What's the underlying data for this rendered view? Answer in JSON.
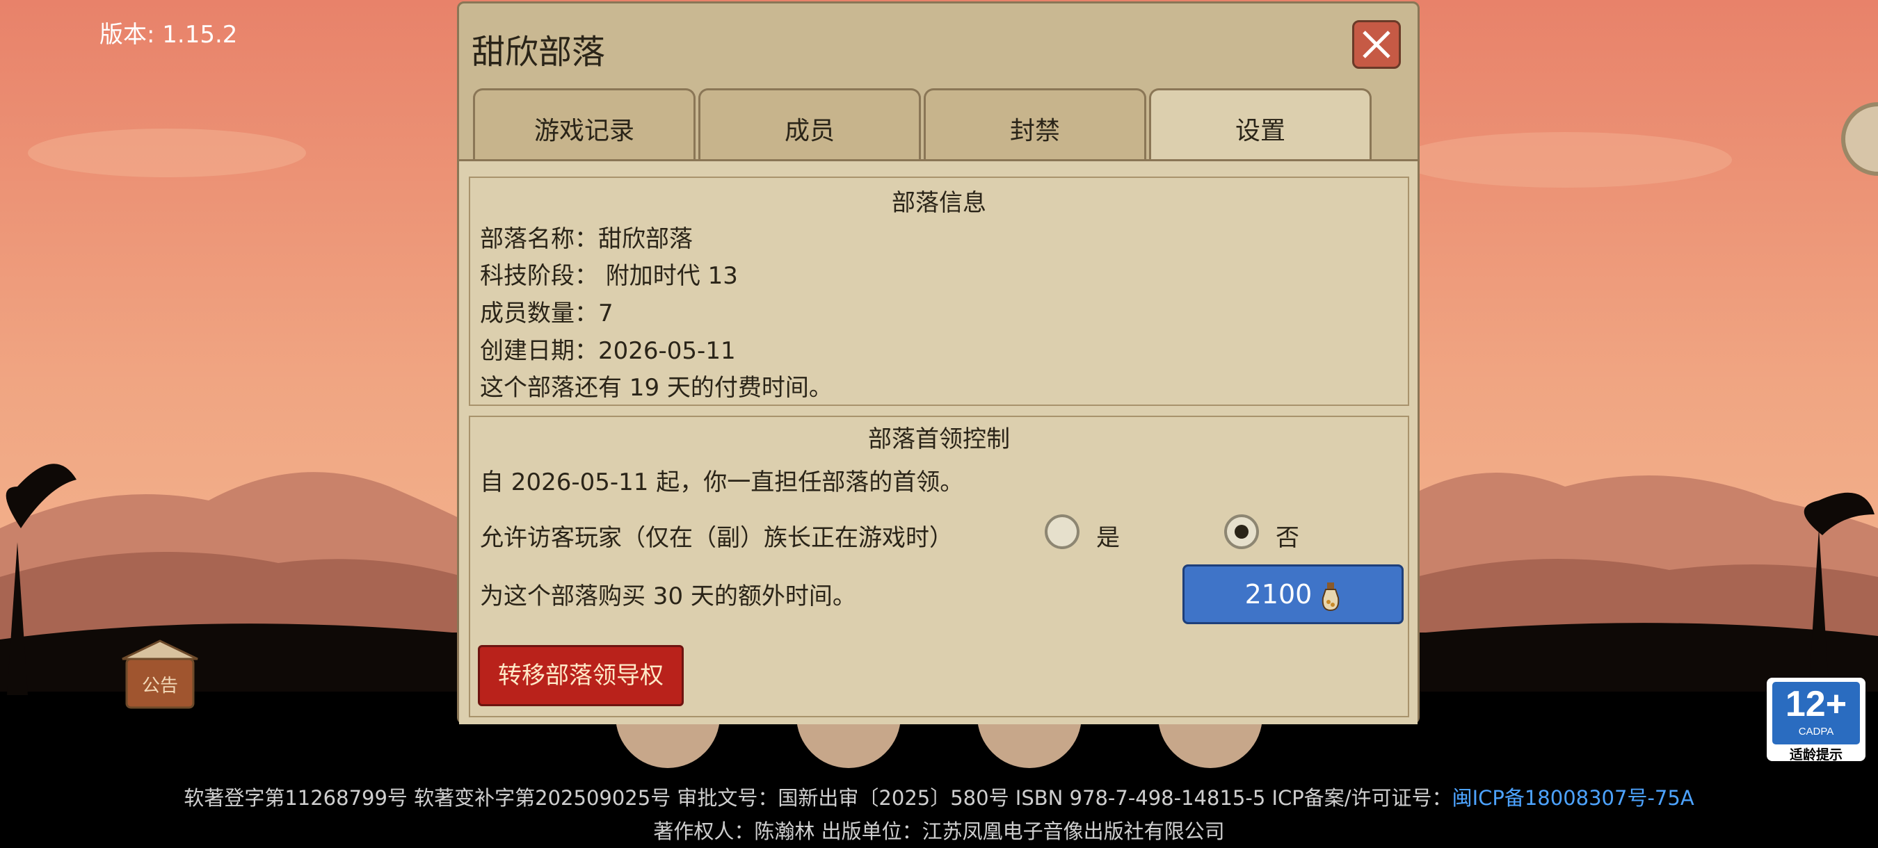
{
  "version_label": "版本: 1.15.2",
  "notice_label": "公告",
  "age_rating": {
    "number": "12+",
    "org": "CADPA",
    "tip": "适龄提示"
  },
  "footer": {
    "line1": "软著登字第11268799号 软著变补字第202509025号 审批文号：国新出审〔2025〕580号 ISBN 978-7-498-14815-5 ICP备案/许可证号：",
    "icp": "闽ICP备18008307号-75A",
    "line2": "著作权人：陈瀚林 出版单位：江苏凤凰电子音像出版社有限公司"
  },
  "dialog": {
    "title": "甜欣部落",
    "tabs": [
      {
        "label": "游戏记录"
      },
      {
        "label": "成员"
      },
      {
        "label": "封禁"
      },
      {
        "label": "设置"
      }
    ],
    "active_tab": "设置",
    "info": {
      "title": "部落信息",
      "name": "部落名称：甜欣部落",
      "tech": "科技阶段： 附加时代 13",
      "members": "成员数量：7",
      "created": "创建日期：2026-05-11",
      "paid": "这个部落还有 19 天的付费时间。"
    },
    "leader": {
      "title": "部落首领控制",
      "since": "自 2026-05-11 起，你一直担任部落的首领。",
      "visitor_label": "允许访客玩家（仅在（副）族长正在游戏时）",
      "yes": "是",
      "no": "否",
      "selected": "否",
      "buy_text": "为这个部落购买 30 天的额外时间。",
      "buy_price": "2100",
      "transfer": "转移部落领导权"
    }
  },
  "colors": {
    "accent_blue": "#3f74c8",
    "danger_red": "#b9221b",
    "panel": "#dccfae",
    "icp_link": "#4da3ff"
  }
}
